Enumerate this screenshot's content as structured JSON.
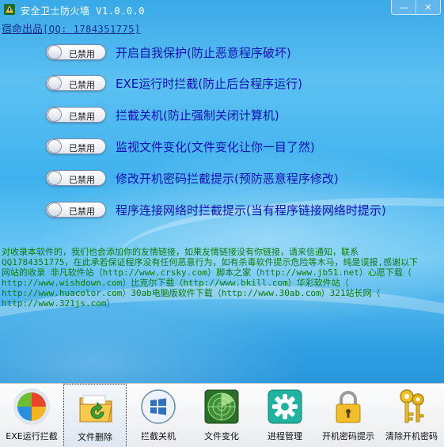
{
  "window": {
    "title": "安全卫士防火墙 V1.0.0.0",
    "icon": "shield-firewall-icon",
    "controls": [
      {
        "name": "minimize",
        "glyph": "—"
      },
      {
        "name": "close",
        "glyph": "✕"
      }
    ]
  },
  "credit": {
    "text": "宿命出品",
    "qq": "[QQ: 1784351775]"
  },
  "options": [
    {
      "state": "已禁用",
      "label": "开启自我保护(防止恶意程序破坏)"
    },
    {
      "state": "已禁用",
      "label": "EXE运行时拦截(防止后台程序运行)"
    },
    {
      "state": "已禁用",
      "label": "拦截关机(防止强制关闭计算机)"
    },
    {
      "state": "已禁用",
      "label": "监视文件变化(文件变化让你一目了然)"
    },
    {
      "state": "已禁用",
      "label": "修改开机密码拦截提示(预防恶意程序修改)"
    },
    {
      "state": "已禁用",
      "label": "程序连接网络时拦截提示(当有程序链接网络时提示)"
    }
  ],
  "notice": {
    "lines": [
      "  对收录本软件的，我们也会添加你的友情链接，如果友情链接没有你链接，请来信通知，联系",
      "QQ1784351775，在此承若保证程序没有任何恶意行为，如有杀毒软件提示危险等木马，纯是误报,感谢以下",
      "网站的收录 非凡软件站（http://www.crsky.com）脚本之家（http://www.jb51.net）心愿下载（",
      "http://www.wishdown.com）比克尔下载（http://www.bkill.com）华彩软件站（",
      "http://www.huacolor.com）30ab电脑版软件下载（http://www.30ab.com）321站长网（",
      "http://www.321js.com）"
    ]
  },
  "toolbar": {
    "items": [
      {
        "label": "EXE运行拦截",
        "icon": "windows-orb-icon"
      },
      {
        "label": "文件删除",
        "icon": "folder-restore-icon"
      },
      {
        "label": "拦截关机",
        "icon": "windows-logo-icon"
      },
      {
        "label": "文件变化",
        "icon": "radar-scan-icon"
      },
      {
        "label": "进程管理",
        "icon": "gear-icon"
      },
      {
        "label": "开机密码提示",
        "icon": "padlock-icon"
      },
      {
        "label": "清除开机密码",
        "icon": "keys-icon"
      }
    ],
    "active_index": 1
  }
}
